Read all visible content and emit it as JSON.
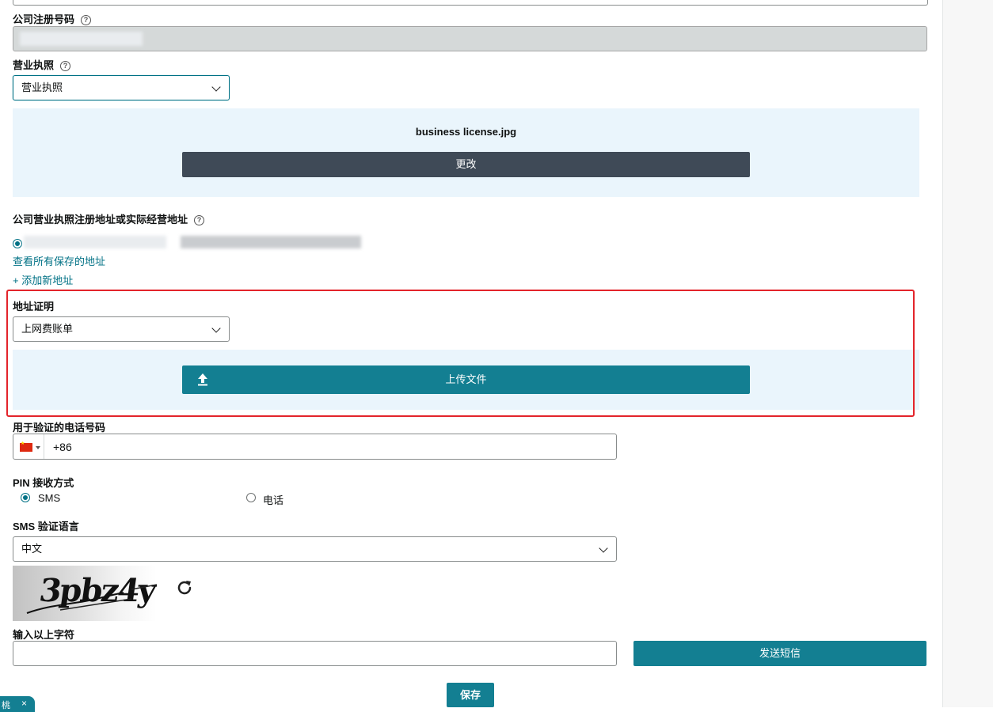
{
  "form": {
    "reg_number_label": "公司注册号码",
    "license_label": "营业执照",
    "license_select_value": "营业执照",
    "license_file_name": "business license.jpg",
    "change_button": "更改",
    "address_label": "公司营业执照注册地址或实际经营地址",
    "view_saved_addresses": "查看所有保存的地址",
    "add_address": "+ 添加新地址",
    "address_proof_label": "地址证明",
    "address_proof_value": "上网费账单",
    "upload_button": "上传文件",
    "phone_label": "用于验证的电话号码",
    "phone_value": "+86",
    "pin_label": "PIN 接收方式",
    "pin_options": [
      "SMS",
      "电话"
    ],
    "sms_lang_label": "SMS 验证语言",
    "sms_lang_value": "中文",
    "captcha_text": "3pbz4y",
    "captcha_input_label": "输入以上字符",
    "send_sms_button": "发送短信",
    "save_button": "保存"
  },
  "help_glyph": "?",
  "badge": {
    "text": "桃",
    "close": "×"
  },
  "colors": {
    "accent": "#137f92",
    "dark_button": "#3f4a57",
    "panel": "#eaf5fc",
    "highlight_box": "#e3242b"
  }
}
